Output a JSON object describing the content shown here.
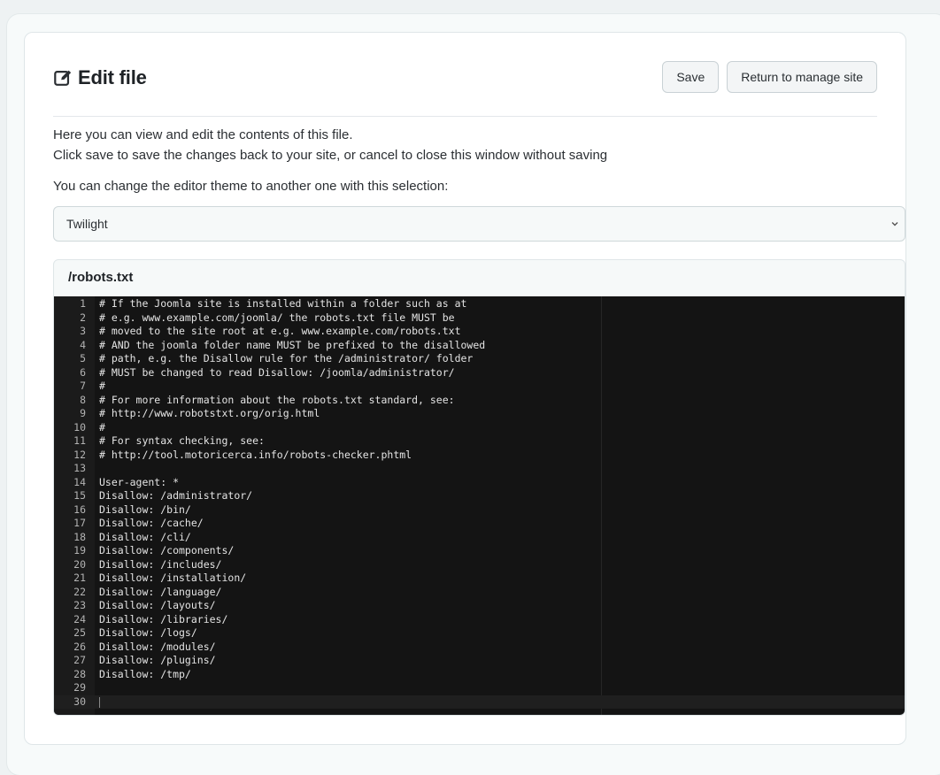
{
  "header": {
    "title": "Edit file",
    "save_label": "Save",
    "return_label": "Return to manage site"
  },
  "description": {
    "line1": "Here you can view and edit the contents of this file.",
    "line2": "Click save to save the changes back to your site, or cancel to close this window without saving"
  },
  "theme": {
    "label": "You can change the editor theme to another one with this selection:",
    "selected": "Twilight"
  },
  "file": {
    "path": "/robots.txt",
    "lines": [
      "# If the Joomla site is installed within a folder such as at",
      "# e.g. www.example.com/joomla/ the robots.txt file MUST be",
      "# moved to the site root at e.g. www.example.com/robots.txt",
      "# AND the joomla folder name MUST be prefixed to the disallowed",
      "# path, e.g. the Disallow rule for the /administrator/ folder",
      "# MUST be changed to read Disallow: /joomla/administrator/",
      "#",
      "# For more information about the robots.txt standard, see:",
      "# http://www.robotstxt.org/orig.html",
      "#",
      "# For syntax checking, see:",
      "# http://tool.motoricerca.info/robots-checker.phtml",
      "",
      "User-agent: *",
      "Disallow: /administrator/",
      "Disallow: /bin/",
      "Disallow: /cache/",
      "Disallow: /cli/",
      "Disallow: /components/",
      "Disallow: /includes/",
      "Disallow: /installation/",
      "Disallow: /language/",
      "Disallow: /layouts/",
      "Disallow: /libraries/",
      "Disallow: /logs/",
      "Disallow: /modules/",
      "Disallow: /plugins/",
      "Disallow: /tmp/",
      "",
      ""
    ]
  },
  "icons": {
    "title_icon": "edit-icon",
    "select_icon": "chevron-down-icon"
  },
  "colors": {
    "editor_bg": "#141414",
    "editor_text": "#e4e4e4"
  }
}
